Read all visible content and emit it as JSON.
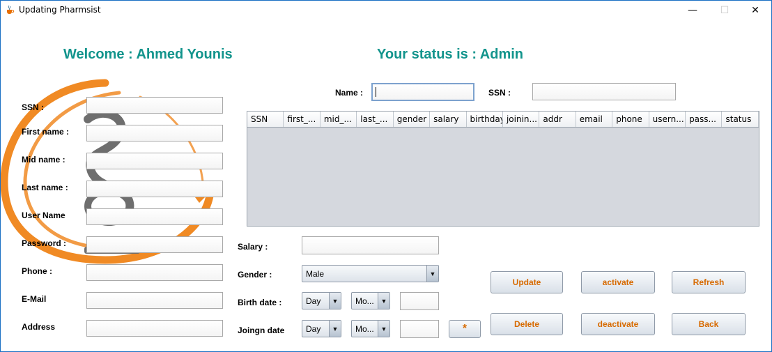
{
  "window": {
    "title": "Updating Pharmsist",
    "minimize_glyph": "—",
    "maximize_glyph": "☐",
    "close_glyph": "✕"
  },
  "header": {
    "welcome": "Welcome : Ahmed Younis",
    "status": "Your status is : Admin"
  },
  "search": {
    "name_label": "Name :",
    "name_value": "",
    "ssn_label": "SSN :",
    "ssn_value": ""
  },
  "form": {
    "ssn_label": "SSN :",
    "first_name_label": "First name :",
    "mid_name_label": "Mid name :",
    "last_name_label": "Last name :",
    "user_name_label": "User Name",
    "password_label": "Password :",
    "phone_label": "Phone :",
    "email_label": "E-Mail",
    "address_label": "Address",
    "salary_label": "Salary :",
    "gender_label": "Gender :",
    "gender_value": "Male",
    "birth_date_label": "Birth date :",
    "birth_day": "Day",
    "birth_month": "Mo...",
    "join_date_label": "Joingn date",
    "join_day": "Day",
    "join_month": "Mo...",
    "star_label": "*"
  },
  "table": {
    "columns": [
      "SSN",
      "first_...",
      "mid_...",
      "last_...",
      "gender",
      "salary",
      "birthday",
      "joinin...",
      "addr",
      "email",
      "phone",
      "usern...",
      "pass...",
      "status"
    ],
    "rows": []
  },
  "buttons": {
    "update": "Update",
    "activate": "activate",
    "refresh": "Refresh",
    "delete": "Delete",
    "deactivate": "deactivate",
    "back": "Back"
  },
  "colors": {
    "heading": "#12948c",
    "button_text": "#d76a00",
    "logo_orange": "#f08a24"
  },
  "icons": {
    "app": "java-cup-icon",
    "logo": "pharmacy-bowl-of-hygieia-logo"
  }
}
